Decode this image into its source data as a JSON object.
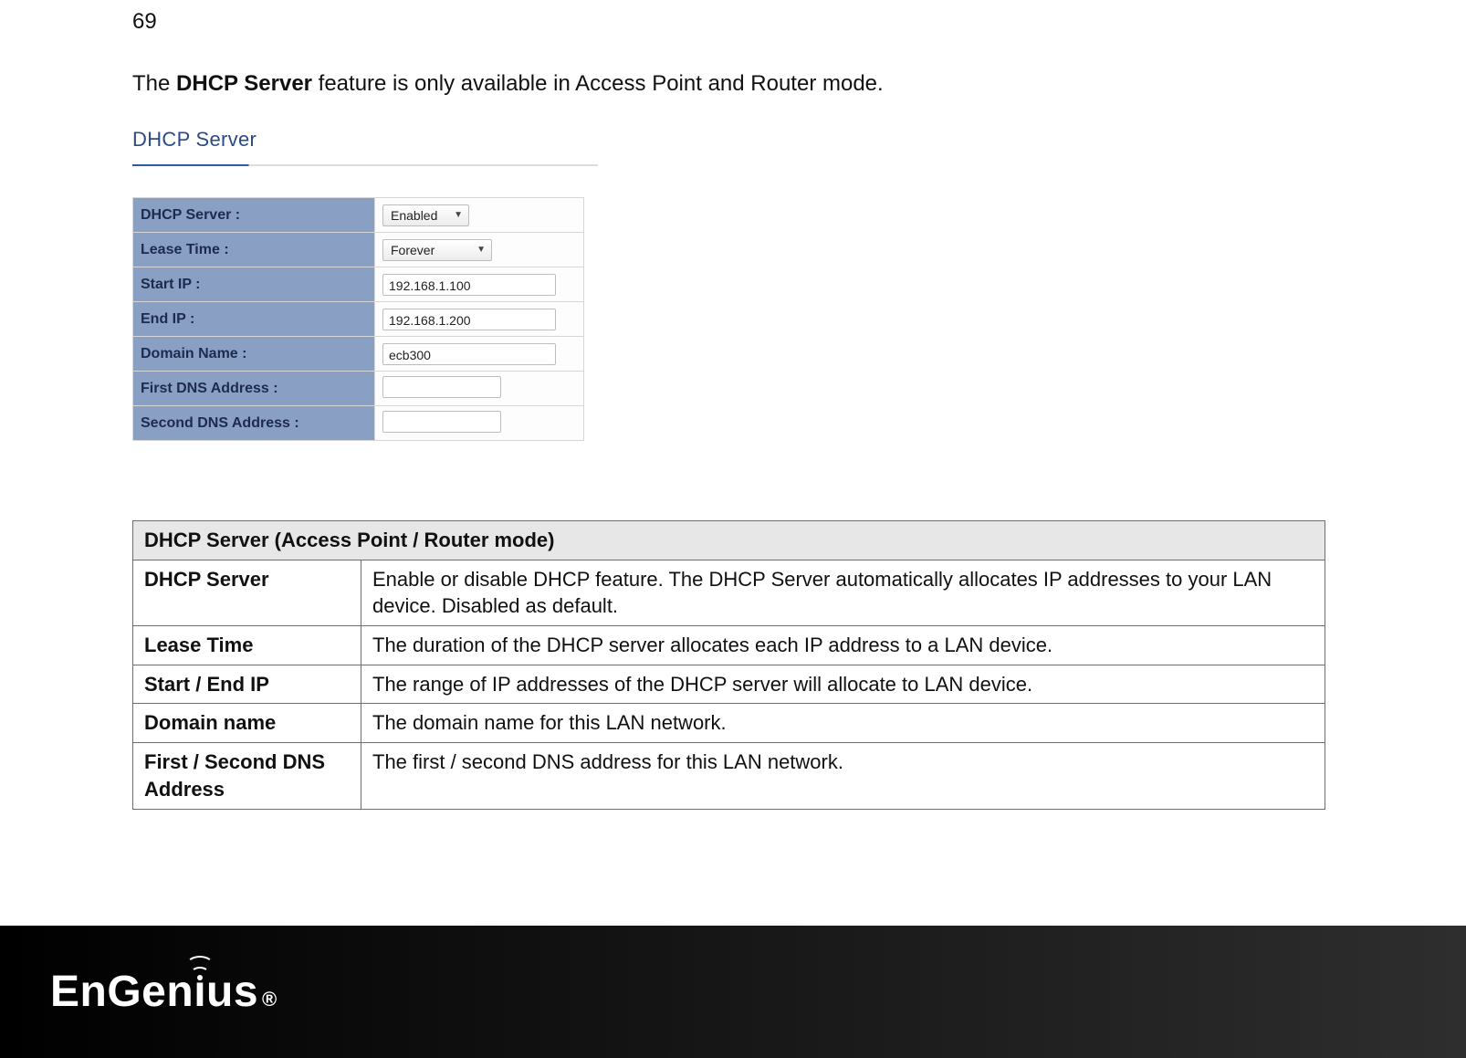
{
  "page_number": "69",
  "intro": {
    "prefix": "The ",
    "bold": "DHCP Server",
    "suffix": " feature is only available in Access Point and Router mode."
  },
  "screenshot": {
    "title": "DHCP Server",
    "rows": {
      "dhcp_server": {
        "label": "DHCP Server :",
        "value": "Enabled"
      },
      "lease_time": {
        "label": "Lease Time :",
        "value": "Forever"
      },
      "start_ip": {
        "label": "Start IP :",
        "value": "192.168.1.100"
      },
      "end_ip": {
        "label": "End IP :",
        "value": "192.168.1.200"
      },
      "domain_name": {
        "label": "Domain Name :",
        "value": "ecb300"
      },
      "first_dns": {
        "label": "First DNS Address :",
        "value": ""
      },
      "second_dns": {
        "label": "Second DNS Address :",
        "value": ""
      }
    }
  },
  "desc_table": {
    "header": "DHCP Server (Access Point / Router mode)",
    "rows": [
      {
        "name": "DHCP Server",
        "desc": "Enable or disable DHCP feature. The DHCP Server automatically allocates IP addresses to your LAN device. Disabled as default."
      },
      {
        "name": "Lease Time",
        "desc": "The duration of the DHCP server allocates each IP address to a LAN device."
      },
      {
        "name": "Start / End IP",
        "desc": "The range of IP addresses of the DHCP server will allocate to LAN device."
      },
      {
        "name": "Domain name",
        "desc": "The domain name for this LAN network."
      },
      {
        "name": "First / Second DNS Address",
        "desc": "The first / second DNS address for this LAN network."
      }
    ]
  },
  "footer": {
    "brand_a": "EnGen",
    "brand_i": "ı",
    "brand_b": "us",
    "reg": "®"
  }
}
